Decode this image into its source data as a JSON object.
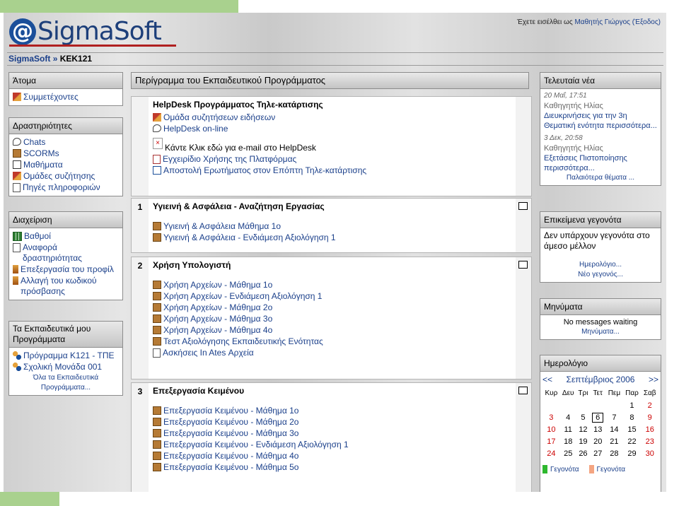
{
  "header": {
    "brand": "SigmaSoft",
    "login_prefix": "Έχετε εισέλθει ως",
    "login_user": "Μαθητής Γιώργος",
    "logout": "(Έξοδος)"
  },
  "breadcrumb": {
    "home": "SigmaSoft",
    "sep": "»",
    "current": "ΚΕΚ121"
  },
  "left": {
    "people": {
      "title": "Άτομα",
      "items": [
        "Συμμετέχοντες"
      ]
    },
    "activities": {
      "title": "Δραστηριότητες",
      "items": [
        "Chats",
        "SCORMs",
        "Μαθήματα",
        "Ομάδες συζήτησης",
        "Πηγές πληροφοριών"
      ]
    },
    "admin": {
      "title": "Διαχείριση",
      "items": [
        "Βαθμοί",
        "Αναφορά δραστηριότητας",
        "Επεξεργασία του προφίλ",
        "Αλλαγή του κωδικού πρόσβασης"
      ]
    },
    "courses": {
      "title": "Τα Εκπαιδευτικά μου Προγράμματα",
      "items": [
        "Πρόγραμμα Κ121 - ΤΠΕ",
        "Σχολική Μονάδα 001"
      ],
      "all_link": "Όλα τα Εκπαιδευτικά Προγράμματα..."
    }
  },
  "center": {
    "outline_title": "Περίγραμμα του Εκπαιδευτικού Προγράμματος",
    "intro": {
      "title": "HelpDesk Προγράμματος Τηλε-κατάρτισης",
      "items": [
        "Ομάδα συζητήσεων ειδήσεων",
        "HelpDesk on-line",
        "Κάντε Κλικ εδώ για e-mail στο HelpDesk",
        "Εγχειρίδιο Χρήσης της Πλατφόρμας",
        "Αποστολή Ερωτήματος στον Επόπτη Τηλε-κατάρτισης"
      ]
    },
    "sections": [
      {
        "num": "1",
        "title": "Υγιεινή & Ασφάλεια - Αναζήτηση Εργασίας",
        "items": [
          "Υγιεινή & Ασφάλεια Μάθημα 1ο",
          "Υγιεινή & Ασφάλεια - Ενδιάμεση Αξιολόγηση 1"
        ]
      },
      {
        "num": "2",
        "title": "Χρήση Υπολογιστή",
        "items": [
          "Χρήση Αρχείων - Μάθημα 1ο",
          "Χρήση Αρχείων - Ενδιάμεση Αξιολόγηση 1",
          "Χρήση Αρχείων - Μάθημα 2ο",
          "Χρήση Αρχείων - Μάθημα 3ο",
          "Χρήση Αρχείων - Μάθημα 4ο",
          "Τεστ Αξιολόγησης Εκπαιδευτικής Ενότητας",
          "Ασκήσεις In Ates Αρχεία"
        ]
      },
      {
        "num": "3",
        "title": "Επεξεργασία Κειμένου",
        "items": [
          "Επεξεργασία Κειμένου - Μάθημα 1ο",
          "Επεξεργασία Κειμένου - Μάθημα 2ο",
          "Επεξεργασία Κειμένου - Μάθημα 3ο",
          "Επεξεργασία Κειμένου - Ενδιάμεση Αξιολόγηση 1",
          "Επεξεργασία Κειμένου - Μάθημα 4ο",
          "Επεξεργασία Κειμένου - Μάθημα 5ο"
        ]
      }
    ]
  },
  "right": {
    "news": {
      "title": "Τελευταία νέα",
      "posts": [
        {
          "date": "20 Μαΐ, 17:51",
          "author": "Καθηγητής Ηλίας",
          "text": "Διευκρινήσεις για την 3η Θεματική ενότητα περισσότερα..."
        },
        {
          "date": "3 Δεκ, 20:58",
          "author": "Καθηγητής Ηλίας",
          "text": "Εξετάσεις Πιστοποίησης περισσότερα..."
        }
      ],
      "older": "Παλαιότερα θέματα ..."
    },
    "events": {
      "title": "Επικείμενα γεγονότα",
      "text": "Δεν υπάρχουν γεγονότα στο άμεσο μέλλον",
      "calendar_link": "Ημερολόγιο...",
      "new_event": "Νέο γεγονός..."
    },
    "messages": {
      "title": "Μηνύματα",
      "text": "No messages waiting",
      "link": "Μηνύματα..."
    },
    "calendar": {
      "title": "Ημερολόγιο",
      "prev": "<<",
      "next": ">>",
      "month": "Σεπτέμβριος 2006",
      "weekdays": [
        "Κυρ",
        "Δευ",
        "Τρι",
        "Τετ",
        "Πεμ",
        "Παρ",
        "Σαβ"
      ],
      "weeks": [
        [
          "",
          "",
          "",
          "",
          "",
          "1",
          "2"
        ],
        [
          "3",
          "4",
          "5",
          "6",
          "7",
          "8",
          "9"
        ],
        [
          "10",
          "11",
          "12",
          "13",
          "14",
          "15",
          "16"
        ],
        [
          "17",
          "18",
          "19",
          "20",
          "21",
          "22",
          "23"
        ],
        [
          "24",
          "25",
          "26",
          "27",
          "28",
          "29",
          "30"
        ]
      ],
      "today": "6",
      "legend": [
        "Γεγονότα",
        "Γεγονότα"
      ],
      "colors": {
        "weekend": "#cc0000",
        "legend1": "#2eb82e",
        "legend2": "#f4a582"
      }
    }
  }
}
